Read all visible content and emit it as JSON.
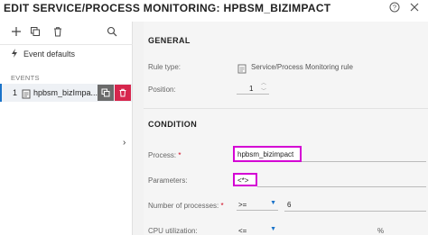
{
  "window": {
    "title": "EDIT SERVICE/PROCESS MONITORING: HPBSM_BIZIMPACT",
    "help_glyph": "?",
    "close_glyph": "✕"
  },
  "sidebar": {
    "event_defaults_label": "Event defaults",
    "events_heading": "EVENTS",
    "events": [
      {
        "index": "1",
        "name": "hpbsm_bizImpa..."
      }
    ],
    "expand_glyph": "›"
  },
  "main": {
    "general": {
      "heading": "GENERAL",
      "rule_type_label": "Rule type:",
      "rule_type_value": "Service/Process Monitoring rule",
      "position_label": "Position:",
      "position_value": "1"
    },
    "condition": {
      "heading": "CONDITION",
      "process_label": "Process:",
      "process_value": "hpbsm_bizimpact",
      "parameters_label": "Parameters:",
      "parameters_value": "<*>",
      "num_processes_label": "Number of processes:",
      "num_processes_operator": ">=",
      "num_processes_value": "6",
      "cpu_label": "CPU utilization:",
      "cpu_operator": "<=",
      "cpu_unit": "%"
    },
    "required_marker": "*"
  },
  "colors": {
    "accent": "#1a73c9",
    "highlight": "#d400d4",
    "delete": "#d6264d",
    "required": "#d0021b"
  }
}
